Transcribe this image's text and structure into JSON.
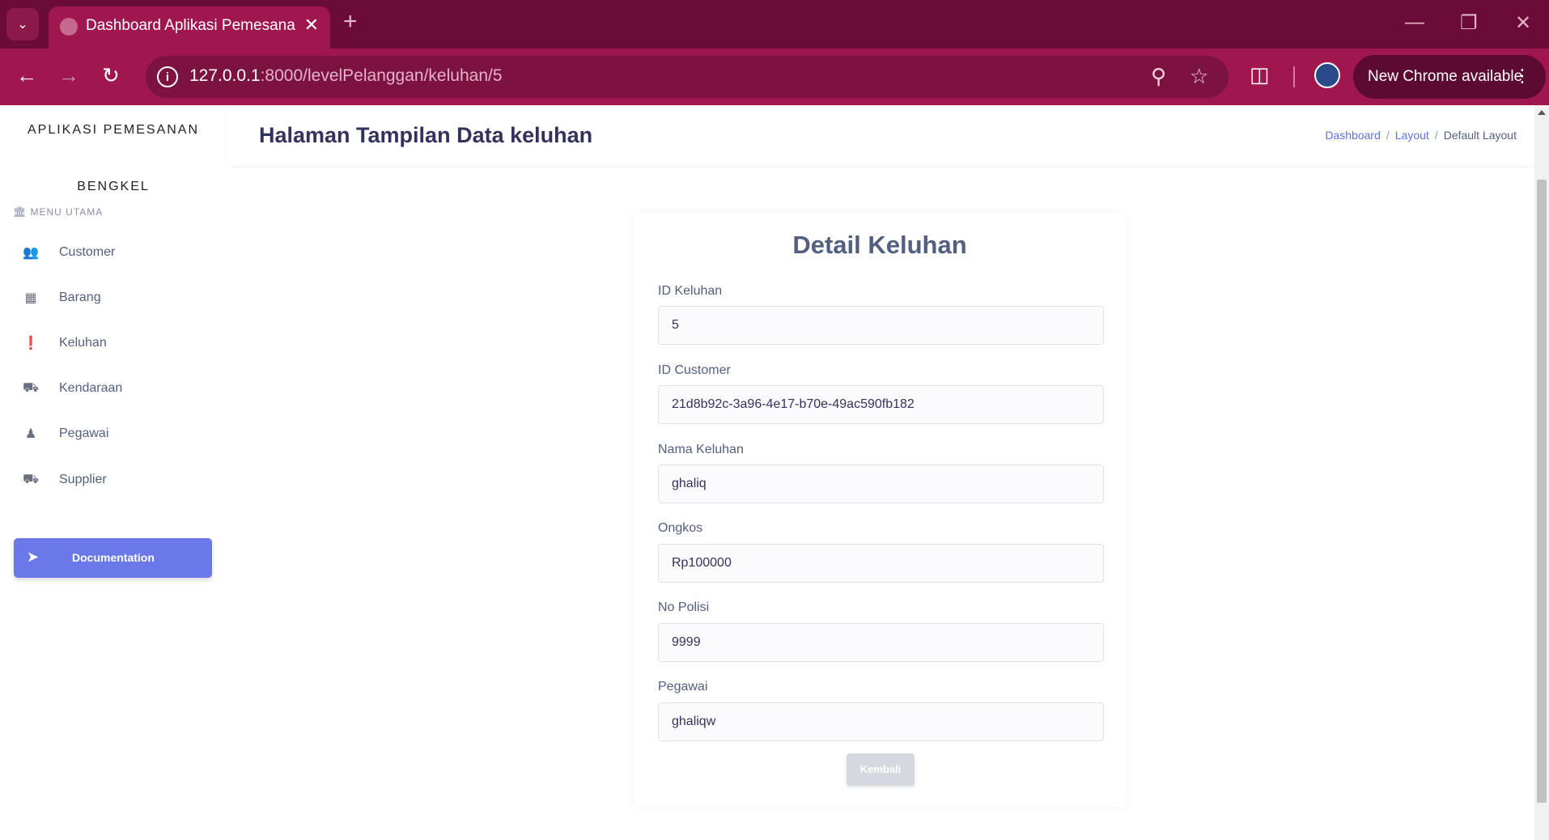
{
  "browser": {
    "tab_title": "Dashboard Aplikasi Pemesanan",
    "url_host": "127.0.0.1",
    "url_rest": ":8000/levelPelanggan/keluhan/5",
    "update_label": "New Chrome available"
  },
  "sidebar": {
    "brand_line1": "APLIKASI PEMESANAN",
    "brand_line2": "BENGKEL",
    "menu_header": "MENU UTAMA",
    "items": [
      {
        "label": "Customer",
        "icon": "users-icon"
      },
      {
        "label": "Barang",
        "icon": "box-icon"
      },
      {
        "label": "Keluhan",
        "icon": "alert-circle-icon"
      },
      {
        "label": "Kendaraan",
        "icon": "car-icon"
      },
      {
        "label": "Pegawai",
        "icon": "user-icon"
      },
      {
        "label": "Supplier",
        "icon": "truck-icon"
      }
    ],
    "doc_button": "Documentation"
  },
  "header": {
    "title": "Halaman Tampilan Data keluhan",
    "breadcrumb": [
      "Dashboard",
      "Layout",
      "Default Layout"
    ]
  },
  "card": {
    "title": "Detail Keluhan",
    "fields": [
      {
        "label": "ID Keluhan",
        "value": "5"
      },
      {
        "label": "ID Customer",
        "value": "21d8b92c-3a96-4e17-b70e-49ac590fb182"
      },
      {
        "label": "Nama Keluhan",
        "value": "ghaliq"
      },
      {
        "label": "Ongkos",
        "value": "Rp100000"
      },
      {
        "label": "No Polisi",
        "value": "9999"
      },
      {
        "label": "Pegawai",
        "value": "ghaliqw"
      }
    ],
    "back_button": "Kembali"
  },
  "colors": {
    "chrome_dark": "#6b0c38",
    "chrome_toolbar": "#a0174f",
    "accent": "#6b79e8",
    "title_text": "#32325d"
  }
}
